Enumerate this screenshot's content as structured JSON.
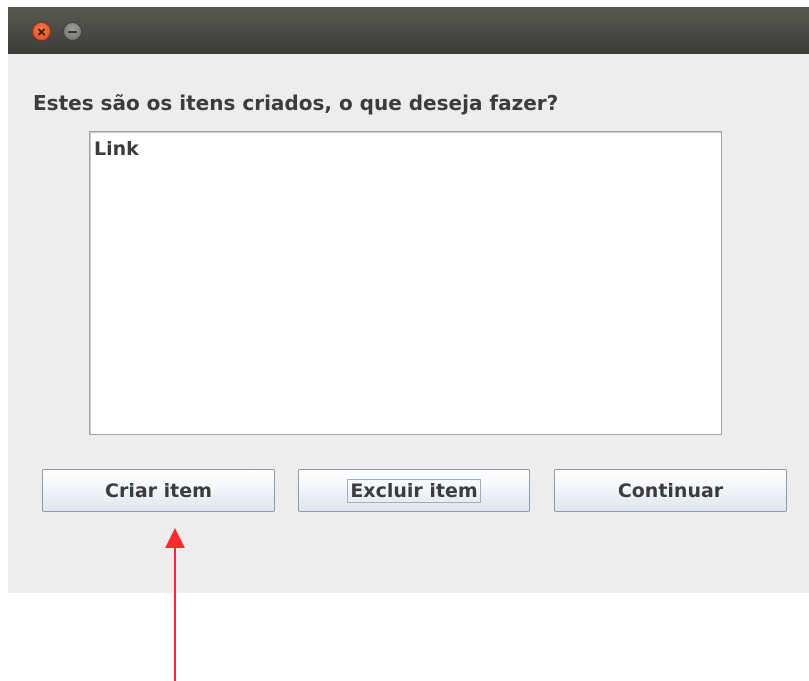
{
  "window": {
    "titlebar_buttons": [
      "close-icon",
      "minimize-icon"
    ]
  },
  "prompt": "Estes são os itens criados, o que deseja fazer?",
  "list": {
    "items": [
      "Link"
    ]
  },
  "buttons": {
    "create": "Criar item",
    "delete": "Excluir item",
    "continue": "Continuar"
  },
  "annotation": {
    "arrow_color": "#ff2a2a",
    "points_to": "create-item-button"
  },
  "colors": {
    "titlebar": "#3c3b37",
    "window_bg": "#ededed",
    "close_button": "#e95420"
  }
}
